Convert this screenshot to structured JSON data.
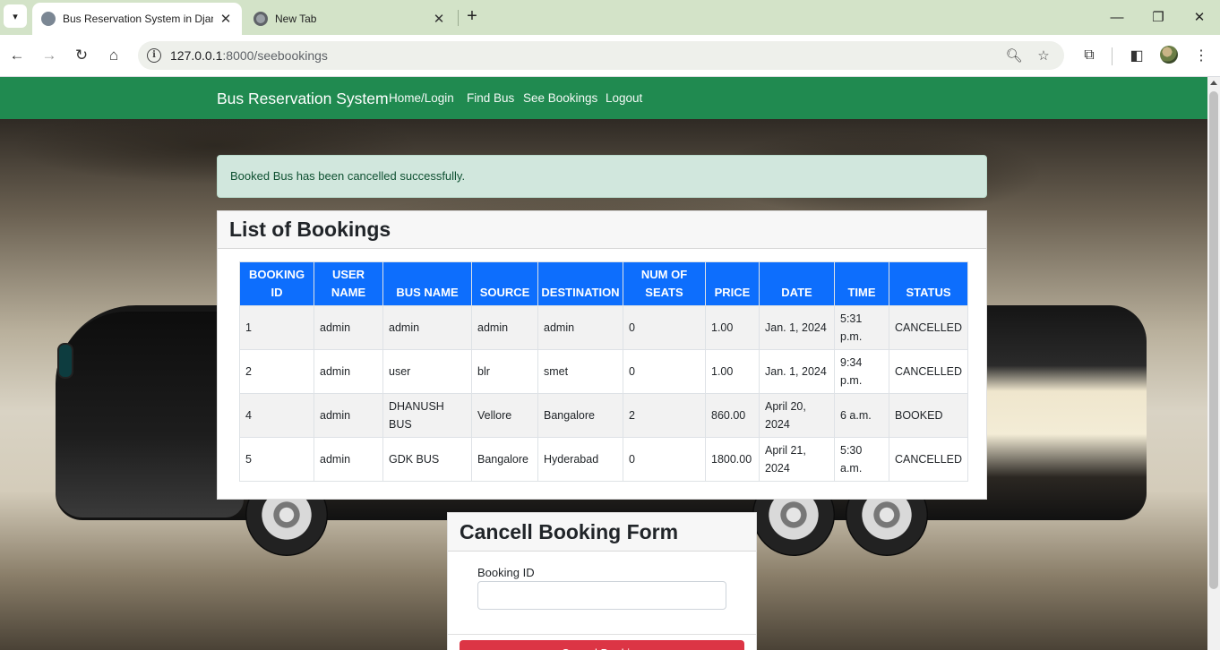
{
  "browser": {
    "tabs": [
      {
        "title": "Bus Reservation System in Djan",
        "active": true
      },
      {
        "title": "New Tab",
        "active": false
      }
    ],
    "url_host": "127.0.0.1",
    "url_path": ":8000/seebookings",
    "icons": [
      "tab-search-icon",
      "back-icon",
      "forward-icon",
      "reload-icon",
      "home-icon",
      "site-info-icon",
      "zoom-icon",
      "bookmark-star-icon",
      "extensions-icon",
      "side-panel-icon",
      "profile-avatar",
      "menu-icon"
    ],
    "window_controls": {
      "minimize": "—",
      "restore": "❐",
      "close": "✕"
    }
  },
  "navbar": {
    "brand": "Bus Reservation System",
    "links": [
      "Home/Login",
      "Find Bus",
      "See Bookings",
      "Logout"
    ],
    "color": "#208a50"
  },
  "alert": {
    "message": "Booked Bus has been cancelled successfully."
  },
  "bookings": {
    "title": "List of Bookings",
    "columns": [
      "BOOKING ID",
      "USER NAME",
      "BUS NAME",
      "SOURCE",
      "DESTINATION",
      "NUM OF SEATS",
      "PRICE",
      "DATE",
      "TIME",
      "STATUS"
    ],
    "rows": [
      [
        "1",
        "admin",
        "admin",
        "admin",
        "admin",
        "0",
        "1.00",
        "Jan. 1, 2024",
        "5:31 p.m.",
        "CANCELLED"
      ],
      [
        "2",
        "admin",
        "user",
        "blr",
        "smet",
        "0",
        "1.00",
        "Jan. 1, 2024",
        "9:34 p.m.",
        "CANCELLED"
      ],
      [
        "4",
        "admin",
        "DHANUSH BUS",
        "Vellore",
        "Bangalore",
        "2",
        "860.00",
        "April 20, 2024",
        "6 a.m.",
        "BOOKED"
      ],
      [
        "5",
        "admin",
        "GDK BUS",
        "Bangalore",
        "Hyderabad",
        "0",
        "1800.00",
        "April 21, 2024",
        "5:30 a.m.",
        "CANCELLED"
      ]
    ],
    "header_color": "#0d6efd"
  },
  "cancel_form": {
    "title": "Cancell Booking Form",
    "field_label": "Booking ID",
    "field_value": "",
    "submit_label": "Cancel Booking",
    "submit_color": "#dc3545"
  }
}
